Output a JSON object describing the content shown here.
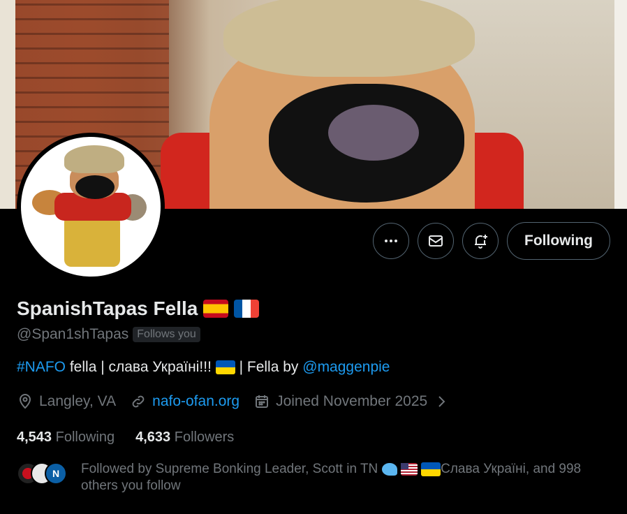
{
  "profile": {
    "display_name": "SpanishTapas Fella",
    "handle": "@Span1shTapas",
    "follows_you_badge": "Follows you",
    "name_flags": [
      "spain-flag",
      "france-flag"
    ]
  },
  "actions": {
    "more_icon": "more-horizontal-icon",
    "message_icon": "envelope-icon",
    "notify_icon": "bell-plus-icon",
    "following_label": "Following"
  },
  "bio": {
    "hashtag": "#NAFO",
    "text_part1": " fella | слава Україні!!! ",
    "text_part2": " | Fella by ",
    "mention": "@maggenpie"
  },
  "meta": {
    "location": "Langley, VA",
    "website": "nafo-ofan.org",
    "joined": "Joined November 2025"
  },
  "stats": {
    "following_count": "4,543",
    "following_label": "Following",
    "followers_count": "4,633",
    "followers_label": "Followers"
  },
  "followed_by": {
    "text_part1": "Followed by Supreme Bonking Leader, Scott in TN ",
    "text_part2": "Слава Україні, and 998 others you follow",
    "avatar3_letter": "N"
  },
  "colors": {
    "background": "#000000",
    "primary_text": "#e7e9ea",
    "secondary_text": "#71767b",
    "link": "#1d9bf0",
    "border": "#536471"
  }
}
